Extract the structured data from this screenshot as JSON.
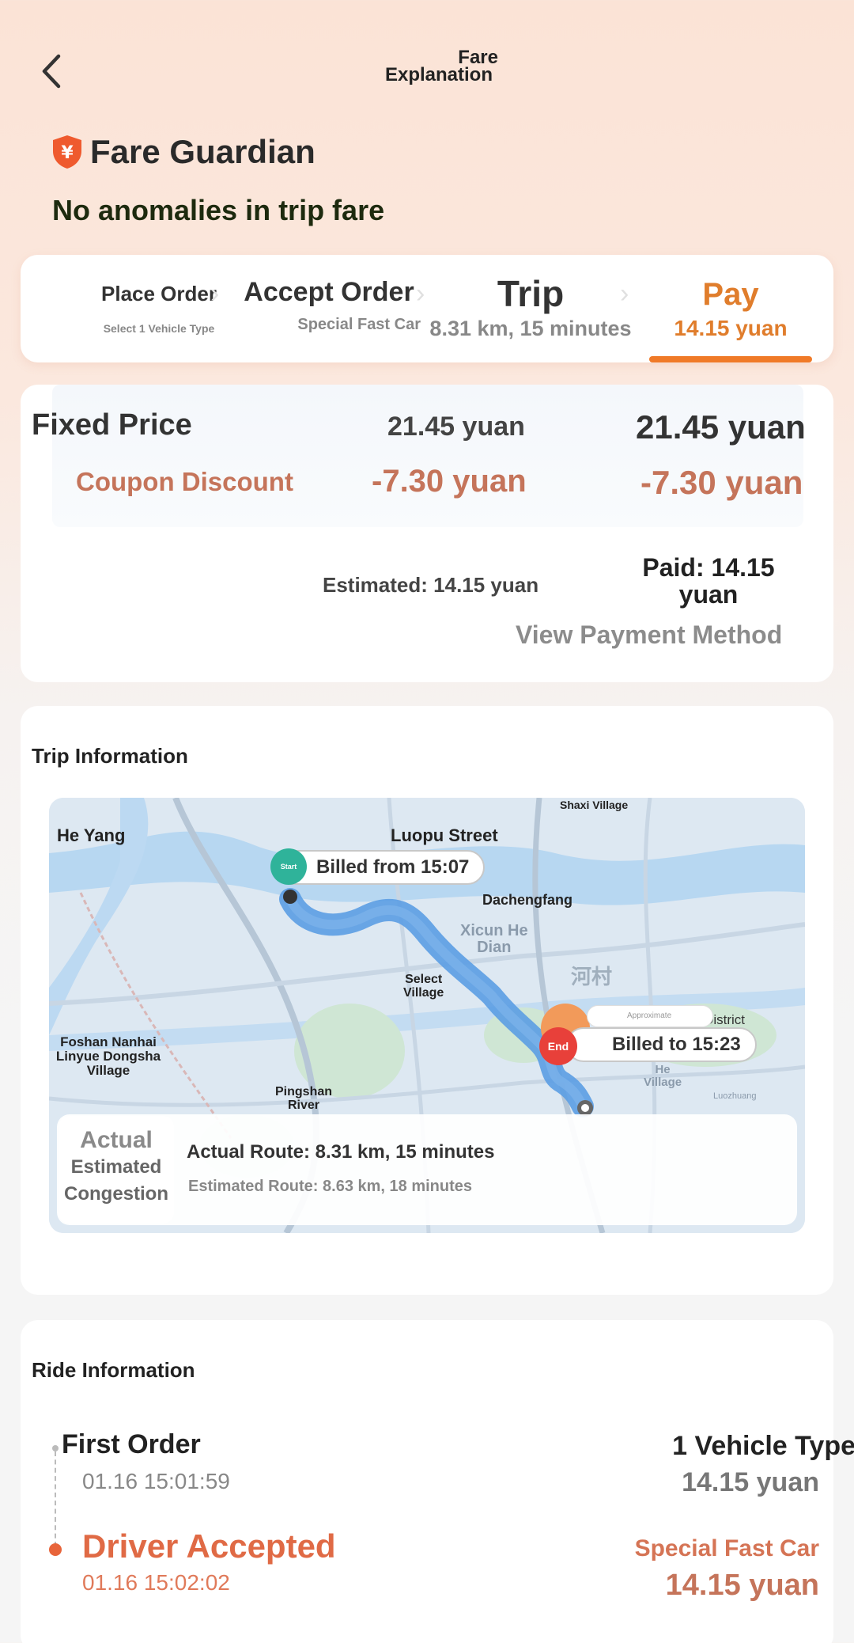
{
  "header": {
    "title_line1": "Fare",
    "title_line2": "Explanation",
    "back": "back"
  },
  "guardian": {
    "title": "Fare Guardian",
    "status": "No anomalies in trip fare",
    "badge_symbol": "¥"
  },
  "steps": [
    {
      "title": "Place Order",
      "sub": "Select 1 Vehicle Type"
    },
    {
      "title": "Accept Order",
      "sub": "Special Fast Car"
    },
    {
      "title": "Trip",
      "sub": "8.31 km, 15 minutes"
    },
    {
      "title": "Pay",
      "sub": "14.15 yuan"
    }
  ],
  "price": {
    "fixed_label": "Fixed Price",
    "fixed_est": "21.45 yuan",
    "fixed_paid": "21.45 yuan",
    "coupon_label": "Coupon Discount",
    "coupon_est": "-7.30 yuan",
    "coupon_paid": "-7.30 yuan",
    "estimated_total": "Estimated: 14.15 yuan",
    "paid_total_line1": "Paid: 14.15",
    "paid_total_line2": "yuan",
    "payment_link": "View Payment Method"
  },
  "trip": {
    "title": "Trip Information",
    "map_labels": {
      "he_yang": "He Yang",
      "luopu": "Luopu Street",
      "shaxi": "Shaxi Village",
      "dachengfang": "Dachengfang",
      "xicun_1": "Xicun He",
      "xicun_2": "Dian",
      "hecun": "河村",
      "select_1": "Select",
      "select_2": "Village",
      "foshan_1": "Foshan Nanhai",
      "foshan_2": "Linyue Dongsha",
      "foshan_3": "Village",
      "pingshan_1": "Pingshan",
      "pingshan_2": "River",
      "jianfu": "Jianfu District",
      "he_village_1": "He",
      "he_village_2": "Village",
      "luozhuang": "Luozhuang",
      "approximate": "Approximate",
      "start_badge": "Start",
      "end_badge": "End",
      "billed_from": "Billed from 15:07",
      "billed_to": "Billed to 15:23"
    },
    "legend": {
      "line1": "Actual",
      "line2": "Estimated",
      "line3": "Congestion"
    },
    "actual_route": "Actual Route: 8.31 km, 15 minutes",
    "estimated_route": "Estimated Route: 8.63 km, 18 minutes"
  },
  "ride": {
    "title": "Ride Information",
    "first_order": "First Order",
    "first_time": "01.16 15:01:59",
    "first_type": "1 Vehicle Type",
    "first_price": "14.15 yuan",
    "accepted": "Driver Accepted",
    "accepted_time": "01.16 15:02:02",
    "accepted_type": "Special Fast Car",
    "accepted_price": "14.15 yuan"
  },
  "colors": {
    "accent": "#f07a28",
    "coupon": "#c5745a",
    "start": "#2fb39a",
    "end": "#e8403a",
    "route": "#5b9de3"
  }
}
